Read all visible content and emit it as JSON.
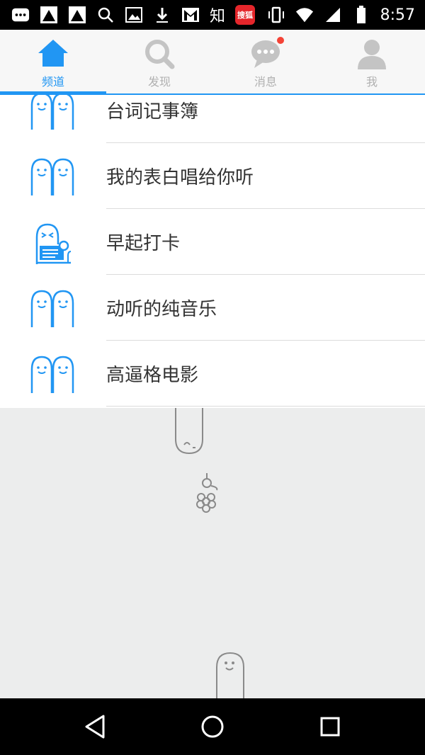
{
  "status_bar": {
    "time": "8:57",
    "zhi_char": "知",
    "badge_text": "搜狐"
  },
  "tabs": [
    {
      "label": "频道",
      "icon": "home-icon",
      "active": true
    },
    {
      "label": "发现",
      "icon": "search-icon",
      "active": false
    },
    {
      "label": "消息",
      "icon": "chat-icon",
      "active": false,
      "has_dot": true
    },
    {
      "label": "我",
      "icon": "person-icon",
      "active": false
    }
  ],
  "channels": [
    {
      "name": "台词记事簿",
      "icon": "ghost-pair-icon"
    },
    {
      "name": "我的表白唱给你听",
      "icon": "ghost-pair-icon"
    },
    {
      "name": "早起打卡",
      "icon": "ghost-laptop-icon"
    },
    {
      "name": "动听的纯音乐",
      "icon": "ghost-pair-icon"
    },
    {
      "name": "高逼格电影",
      "icon": "ghost-pair-icon"
    }
  ],
  "colors": {
    "accent": "#2196f3",
    "badge": "#f44336",
    "background": "#eceded"
  }
}
